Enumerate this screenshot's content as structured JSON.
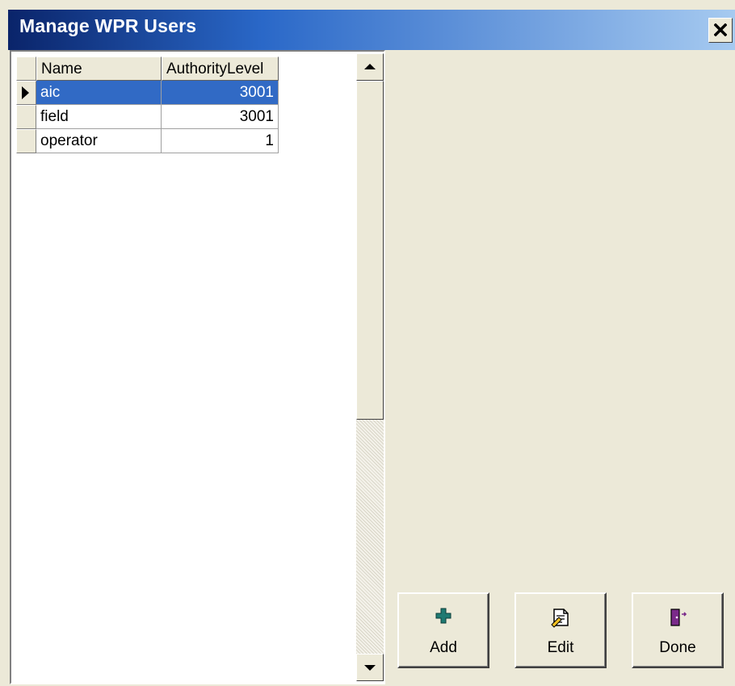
{
  "window": {
    "title": "Manage WPR Users",
    "close_icon": "close-icon"
  },
  "grid": {
    "columns": [
      "Name",
      "AuthorityLevel"
    ],
    "rows": [
      {
        "name": "aic",
        "authority_level": "3001",
        "selected": true
      },
      {
        "name": "field",
        "authority_level": "3001",
        "selected": false
      },
      {
        "name": "operator",
        "authority_level": "1",
        "selected": false
      }
    ],
    "current_row_icon": "row-pointer-icon"
  },
  "buttons": {
    "add": {
      "label": "Add",
      "icon": "plus-icon"
    },
    "edit": {
      "label": "Edit",
      "icon": "edit-document-icon"
    },
    "done": {
      "label": "Done",
      "icon": "exit-door-icon"
    }
  },
  "colors": {
    "titlebar_start": "#0a246a",
    "titlebar_end": "#a6caf0",
    "selection": "#316ac5",
    "face": "#ece9d8"
  }
}
